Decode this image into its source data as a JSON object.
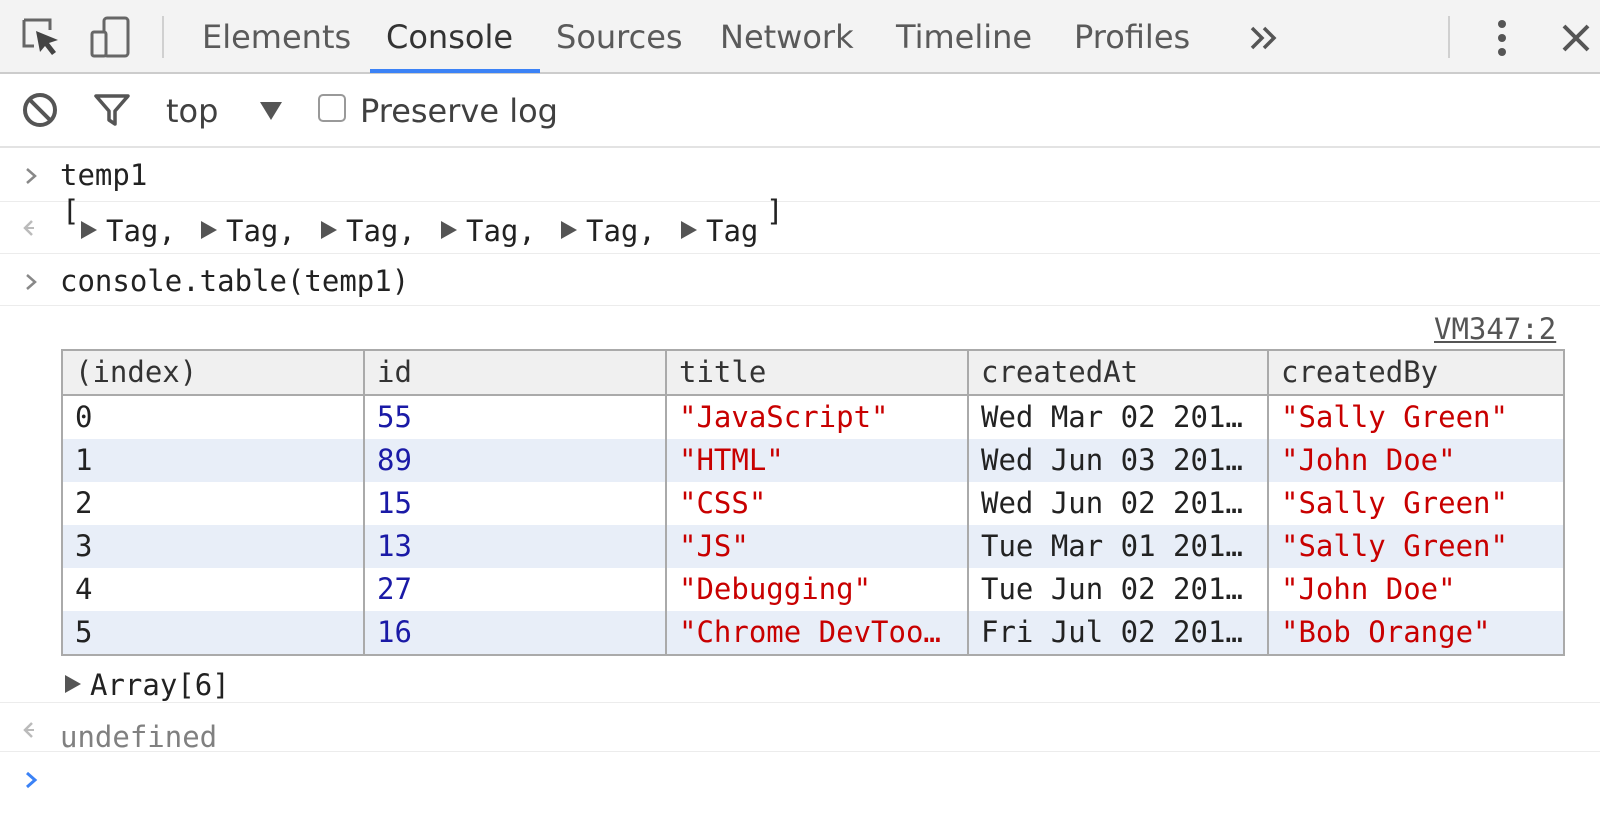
{
  "tabs": [
    {
      "label": "Elements",
      "active": false
    },
    {
      "label": "Console",
      "active": true
    },
    {
      "label": "Sources",
      "active": false
    },
    {
      "label": "Network",
      "active": false
    },
    {
      "label": "Timeline",
      "active": false
    },
    {
      "label": "Profiles",
      "active": false
    }
  ],
  "icons": {
    "inspect": "inspect-element-icon",
    "device": "device-mode-icon",
    "more_tabs": "chevron-double-right-icon",
    "menu": "kebab-menu-icon",
    "close": "close-icon",
    "clear": "clear-console-icon",
    "filter": "filter-icon",
    "dropdown": "dropdown-arrow-icon",
    "input_prompt": "chevron-right-icon",
    "output_prompt": "return-arrow-icon",
    "expand": "expand-triangle-icon"
  },
  "toolbar": {
    "context": "top",
    "preserve_log_label": "Preserve log",
    "preserve_log_checked": false
  },
  "console": {
    "cmd1": "temp1",
    "result1": {
      "open_bracket": "[",
      "items": [
        "Tag,",
        "Tag,",
        "Tag,",
        "Tag,",
        "Tag,",
        "Tag"
      ],
      "close_bracket": "]"
    },
    "cmd2": "console.table(temp1)",
    "source_link": "VM347:2",
    "table": {
      "headers": [
        "(index)",
        "id",
        "title",
        "createdAt",
        "createdBy"
      ],
      "rows": [
        [
          "0",
          "55",
          "\"JavaScript\"",
          "Wed Mar 02 201…",
          "\"Sally Green\""
        ],
        [
          "1",
          "89",
          "\"HTML\"",
          "Wed Jun 03 201…",
          "\"John Doe\""
        ],
        [
          "2",
          "15",
          "\"CSS\"",
          "Wed Jun 02 201…",
          "\"Sally Green\""
        ],
        [
          "3",
          "13",
          "\"JS\"",
          "Tue Mar 01 201…",
          "\"Sally Green\""
        ],
        [
          "4",
          "27",
          "\"Debugging\"",
          "Tue Jun 02 201…",
          "\"John Doe\""
        ],
        [
          "5",
          "16",
          "\"Chrome DevToo…",
          "Fri Jul 02 201…",
          "\"Bob Orange\""
        ]
      ]
    },
    "array_summary": "Array[6]",
    "result2": "undefined"
  },
  "colors": {
    "active_tab_underline": "#3b82f6",
    "number": "#1a1aa6",
    "string": "#c80000",
    "undefined": "#808080",
    "prompt": "#3b82f6"
  }
}
